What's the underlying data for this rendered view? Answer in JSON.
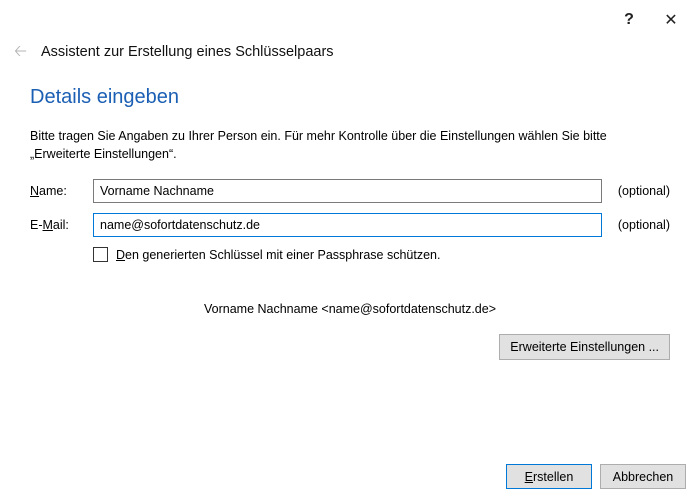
{
  "titlebar": {
    "help": "?",
    "close": "✕"
  },
  "header": {
    "back_glyph": "🡠",
    "title": "Assistent zur Erstellung eines Schlüsselpaars"
  },
  "section": {
    "title": "Details eingeben",
    "instructions": "Bitte tragen Sie Angaben zu Ihrer Person ein. Für mehr Kontrolle über die Einstellungen wählen Sie bitte „Erweiterte Einstellungen“."
  },
  "form": {
    "name_label_pre": "N",
    "name_label_post": "ame:",
    "name_value": "Vorname Nachname",
    "email_label_pre": "E-",
    "email_label_u": "M",
    "email_label_post": "ail:",
    "email_value": "name@sofortdatenschutz.de",
    "optional": "(optional)",
    "passphrase_pre": "D",
    "passphrase_post": "en generierten Schlüssel mit einer Passphrase schützen.",
    "passphrase_checked": false
  },
  "summary": "Vorname Nachname <name@sofortdatenschutz.de>",
  "buttons": {
    "advanced": "Erweiterte Einstellungen ...",
    "create_u": "E",
    "create_post": "rstellen",
    "cancel": "Abbrechen"
  }
}
